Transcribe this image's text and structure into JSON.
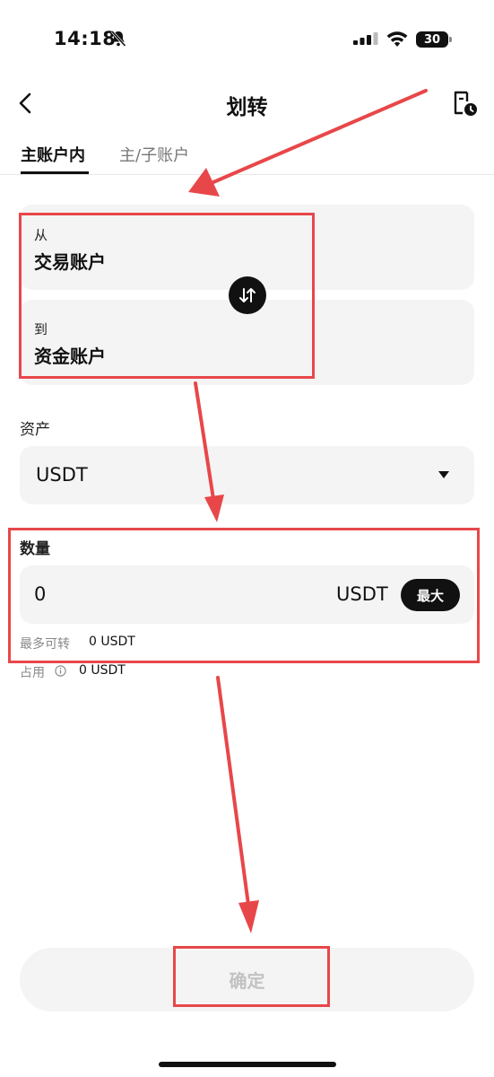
{
  "status_bar": {
    "time": "14:18",
    "battery": "30"
  },
  "header": {
    "title": "划转"
  },
  "tabs": [
    {
      "label": "主账户内",
      "active": true
    },
    {
      "label": "主/子账户",
      "active": false
    }
  ],
  "transfer": {
    "from_label": "从",
    "from_account": "交易账户",
    "to_label": "到",
    "to_account": "资金账户"
  },
  "asset": {
    "label": "资产",
    "selected": "USDT"
  },
  "amount": {
    "label": "数量",
    "value": "0",
    "unit": "USDT",
    "max_label": "最大",
    "max_transferable_label": "最多可转",
    "max_transferable_value": "0 USDT",
    "occupied_label": "占用",
    "occupied_value": "0 USDT"
  },
  "confirm_label": "确定",
  "colors": {
    "annotation": "#e8474a",
    "accent": "#111111",
    "card": "#f4f4f4"
  }
}
